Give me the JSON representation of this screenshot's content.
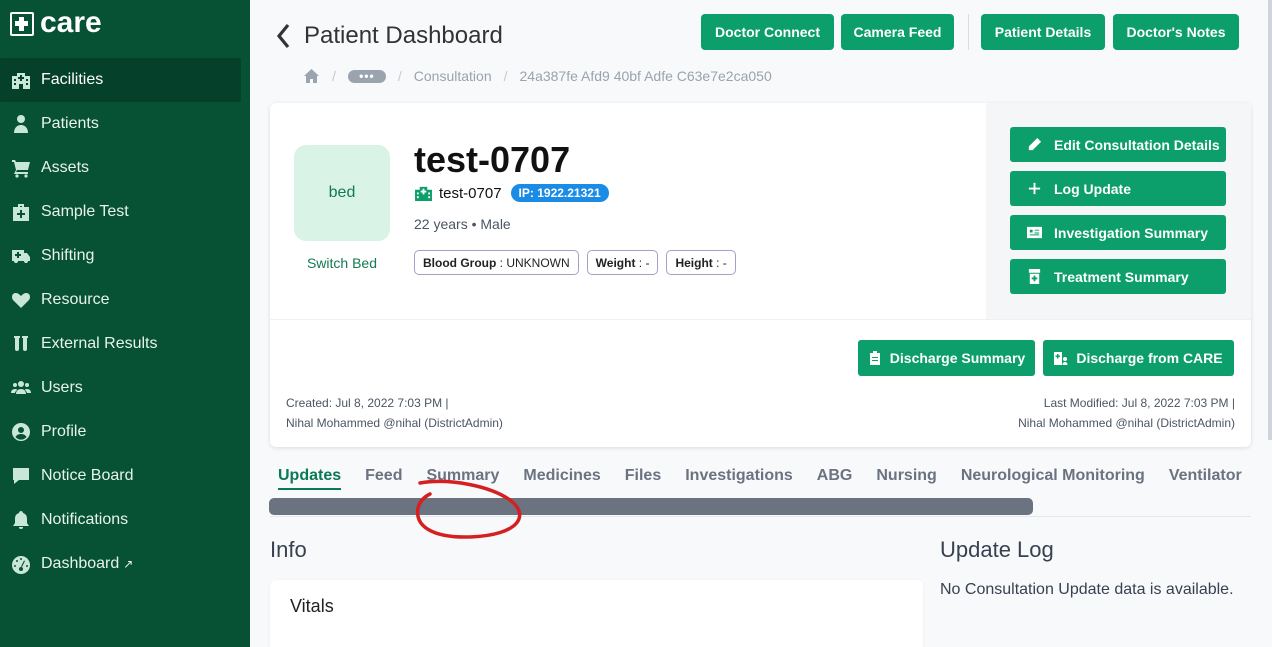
{
  "sidebar": {
    "logo_text": "care",
    "items": [
      {
        "label": "Facilities",
        "icon": "hospital-icon"
      },
      {
        "label": "Patients",
        "icon": "user-injured-icon"
      },
      {
        "label": "Assets",
        "icon": "cart-icon"
      },
      {
        "label": "Sample Test",
        "icon": "medkit-icon"
      },
      {
        "label": "Shifting",
        "icon": "ambulance-icon"
      },
      {
        "label": "Resource",
        "icon": "heartbeat-icon"
      },
      {
        "label": "External Results",
        "icon": "vials-icon"
      },
      {
        "label": "Users",
        "icon": "users-icon"
      },
      {
        "label": "Profile",
        "icon": "user-circle-icon"
      },
      {
        "label": "Notice Board",
        "icon": "comment-icon"
      },
      {
        "label": "Notifications",
        "icon": "bell-icon"
      },
      {
        "label": "Dashboard",
        "icon": "tachometer-icon"
      }
    ],
    "active_item": "Facilities"
  },
  "header": {
    "title": "Patient Dashboard",
    "buttons": [
      "Doctor Connect",
      "Camera Feed",
      "Patient Details",
      "Doctor's Notes"
    ]
  },
  "breadcrumb": {
    "dots": "•••",
    "items": [
      "Consultation",
      "24a387fe Afd9 40bf Adfe C63e7e2ca050"
    ]
  },
  "patient": {
    "bed_label": "bed",
    "switch_bed": "Switch Bed",
    "name": "test-0707",
    "facility_name": "test-0707",
    "ip": "IP: 1922.21321",
    "age_gender": "22 years  •  Male",
    "tags": [
      {
        "label": "Blood Group",
        "value": " : UNKNOWN"
      },
      {
        "label": "Weight",
        "value": " : -"
      },
      {
        "label": "Height",
        "value": " : -"
      }
    ]
  },
  "side_buttons": [
    "Edit Consultation Details",
    "Log Update",
    "Investigation Summary",
    "Treatment Summary"
  ],
  "discharge_buttons": [
    "Discharge Summary",
    "Discharge from CARE"
  ],
  "meta": {
    "created": "Created: Jul 8, 2022 7:03 PM |",
    "created_by": "Nihal Mohammed @nihal (DistrictAdmin)",
    "modified": "Last Modified: Jul 8, 2022 7:03 PM |",
    "modified_by": "Nihal Mohammed @nihal (DistrictAdmin)"
  },
  "tabs": [
    "Updates",
    "Feed",
    "Summary",
    "Medicines",
    "Files",
    "Investigations",
    "ABG",
    "Nursing",
    "Neurological Monitoring",
    "Ventilator"
  ],
  "active_tab": "Updates",
  "info": {
    "heading": "Info",
    "vitals_heading": "Vitals"
  },
  "update_log": {
    "heading": "Update Log",
    "empty_text": "No Consultation Update data is available."
  },
  "colors": {
    "sidebar_bg": "#075134",
    "primary": "#0d9f6b",
    "annotation": "#d42020"
  }
}
